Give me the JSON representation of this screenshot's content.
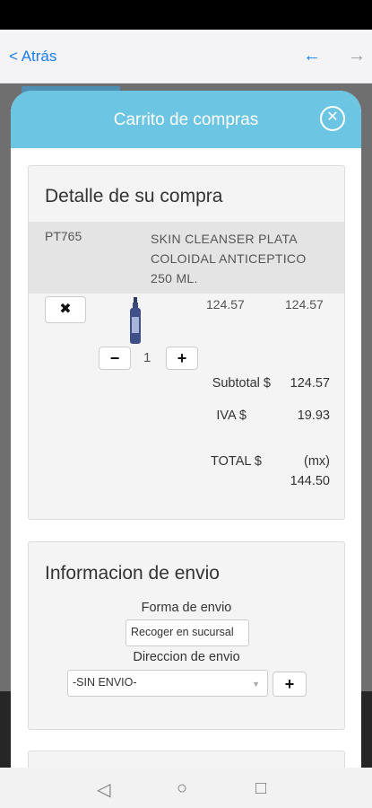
{
  "browser": {
    "back_label": "< Atrás",
    "nav_back_icon": "arrow-left-icon",
    "nav_forward_icon": "arrow-right-icon"
  },
  "modal": {
    "title": "Carrito de compras",
    "close_icon": "close-circle-icon"
  },
  "purchase": {
    "heading": "Detalle de su compra",
    "item": {
      "code": "PT765",
      "description": "SKIN CLEANSER PLATA COLOIDAL ANTICEPTICO 250 ML.",
      "unit_price": "124.57",
      "line_total": "124.57",
      "quantity": "1",
      "remove_label": "✖",
      "minus_label": "−",
      "plus_label": "+"
    },
    "summary": {
      "subtotal_label": "Subtotal $",
      "subtotal_value": "124.57",
      "iva_label": "IVA $",
      "iva_value": "19.93",
      "total_label": "TOTAL $",
      "total_currency": "(mx)",
      "total_value": "144.50"
    }
  },
  "shipping": {
    "heading": "Informacion de envio",
    "method_label": "Forma de envio",
    "method_value": "Recoger en sucursal",
    "address_label": "Direccion de envio",
    "address_value": "-SIN ENVIO-",
    "add_label": "+"
  },
  "system_nav": {
    "back_icon": "triangle-back-icon",
    "home_icon": "circle-home-icon",
    "recents_icon": "square-recents-icon"
  },
  "colors": {
    "header": "#6cc5e2",
    "link": "#1a7cf0"
  }
}
